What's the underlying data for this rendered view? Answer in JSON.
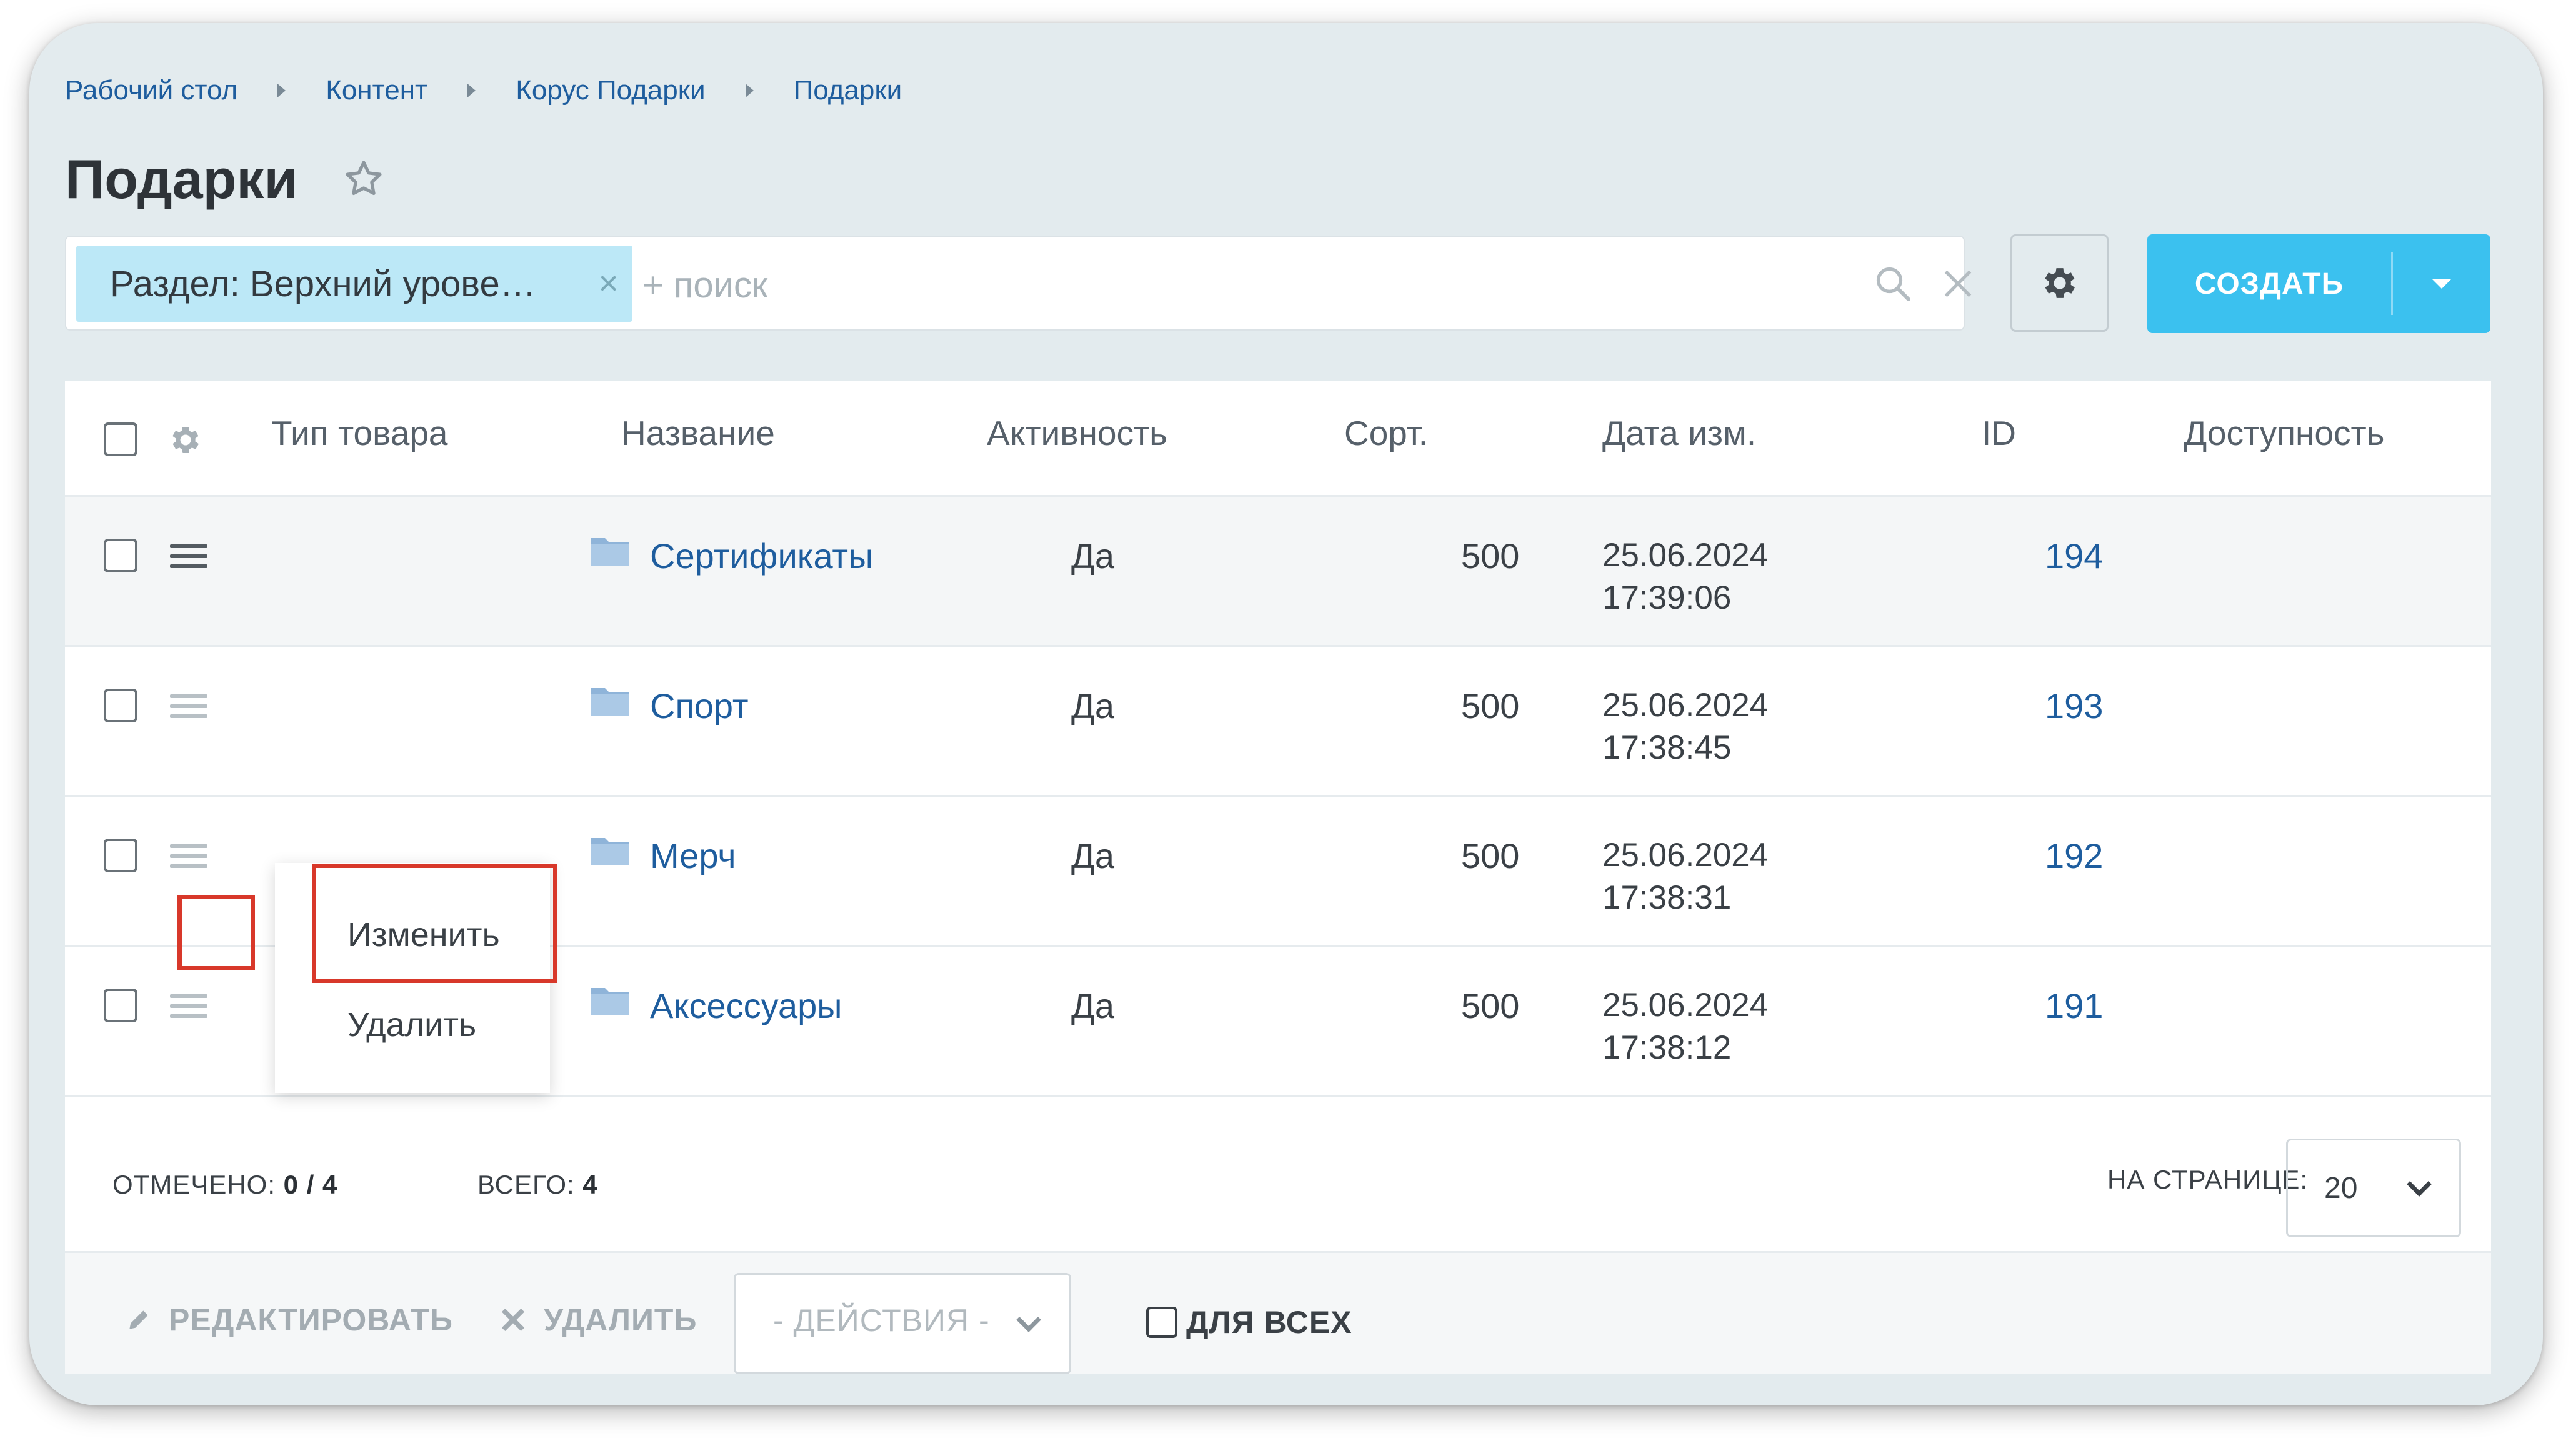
{
  "breadcrumb": [
    "Рабочий стол",
    "Контент",
    "Корус Подарки",
    "Подарки"
  ],
  "page_title": "Подарки",
  "filter": {
    "chip_label": "Раздел: Верхний урове…",
    "search_placeholder": "+ поиск"
  },
  "create_button": "СОЗДАТЬ",
  "table": {
    "columns": [
      "Тип товара",
      "Название",
      "Активность",
      "Сорт.",
      "Дата изм.",
      "ID",
      "Доступность"
    ],
    "rows": [
      {
        "name": "Сертификаты",
        "active": "Да",
        "sort": "500",
        "date": "25.06.2024",
        "time": "17:39:06",
        "id": "194"
      },
      {
        "name": "Спорт",
        "active": "Да",
        "sort": "500",
        "date": "25.06.2024",
        "time": "17:38:45",
        "id": "193"
      },
      {
        "name": "Мерч",
        "active": "Да",
        "sort": "500",
        "date": "25.06.2024",
        "time": "17:38:31",
        "id": "192"
      },
      {
        "name": "Аксессуары",
        "active": "Да",
        "sort": "500",
        "date": "25.06.2024",
        "time": "17:38:12",
        "id": "191"
      }
    ]
  },
  "context_menu": {
    "edit": "Изменить",
    "delete": "Удалить"
  },
  "footer": {
    "selected_label": "ОТМЕЧЕНО:",
    "selected_value": "0 / 4",
    "total_label": "ВСЕГО:",
    "total_value": "4",
    "per_page_label": "НА СТРАНИЦЕ:",
    "per_page_value": "20"
  },
  "actions": {
    "edit": "РЕДАКТИРОВАТЬ",
    "delete": "УДАЛИТЬ",
    "select": "- ДЕЙСТВИЯ -",
    "for_all": "ДЛЯ ВСЕХ"
  },
  "colors": {
    "link": "#1e5d9e",
    "accent": "#3bc1ef",
    "highlight": "#d8382a",
    "chip": "#bce8f7"
  }
}
